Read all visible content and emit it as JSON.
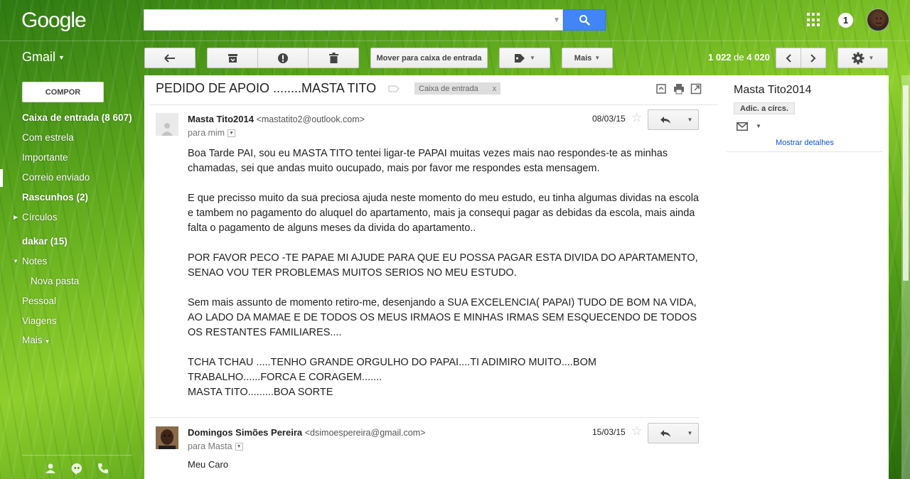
{
  "topbar": {
    "logo": "Google",
    "search": {
      "value": "",
      "placeholder": ""
    },
    "notification_count": "1"
  },
  "app_label": "Gmail",
  "toolbar": {
    "move_to_inbox": "Mover para caixa de entrada",
    "more": "Mais",
    "count_range": "1 022",
    "count_of": "de",
    "count_total": "4 020"
  },
  "sidebar": {
    "compose": "COMPOR",
    "items": [
      {
        "label": "Caixa de entrada (8 607)"
      },
      {
        "label": "Com estrela"
      },
      {
        "label": "Importante"
      },
      {
        "label": "Correio enviado"
      },
      {
        "label": "Rascunhos (2)"
      },
      {
        "label": "Círculos"
      },
      {
        "label": "dakar (15)"
      },
      {
        "label": "Notes"
      },
      {
        "label": "Nova pasta"
      },
      {
        "label": "Pessoal"
      },
      {
        "label": "Viagens"
      },
      {
        "label": "Mais"
      }
    ]
  },
  "thread": {
    "subject": "PEDIDO DE APOIO ........MASTA TITO",
    "label_chip": "Caixa de entrada",
    "label_chip_close": "x",
    "messages": [
      {
        "sender_name": "Masta Tito2014",
        "sender_email": "<mastatito2@outlook.com>",
        "to": "para mim",
        "date": "08/03/15",
        "body": [
          "Boa Tarde PAI, sou eu MASTA TITO tentei ligar-te PAPAI muitas vezes mais nao respondes-te  as minhas chamadas, sei que andas muito oucupado, mais por favor me respondes esta mensagem.",
          "E que precisso muito da sua preciosa ajuda neste momento do meu estudo, eu tinha algumas dividas na escola e tambem no pagamento do aluquel do apartamento, mais ja consequi pagar as debidas da escola, mais ainda falta o pagamento de alguns meses da divida do apartamento..",
          "POR FAVOR PECO -TE PAPAE MI AJUDE PARA QUE EU POSSA PAGAR ESTA DIVIDA DO APARTAMENTO, SENAO VOU TER PROBLEMAS MUITOS SERIOS NO MEU ESTUDO.",
          "Sem mais assunto de momento retiro-me, desenjando a SUA EXCELENCIA( PAPAI) TUDO DE BOM NA VIDA, AO LADO DA MAMAE E DE TODOS OS MEUS IRMAOS E MINHAS IRMAS SEM ESQUECENDO DE TODOS OS RESTANTES FAMILIARES....",
          "TCHA TCHAU .....TENHO GRANDE ORGULHO DO PAPAI....TI ADIMIRO MUITO....BOM TRABALHO......FORCA E CORAGEM.......",
          "MASTA TITO.........BOA SORTE"
        ]
      },
      {
        "sender_name": "Domingos Simões Pereira",
        "sender_email": "<dsimoespereira@gmail.com>",
        "to": "para Masta",
        "date": "15/03/15",
        "body_preview": "Meu Caro"
      }
    ]
  },
  "contact_panel": {
    "name": "Masta Tito2014",
    "add_to_circles": "Adic. a círcs.",
    "show_details": "Mostrar detalhes"
  },
  "colors": {
    "search_button": "#4285f4",
    "link": "#1155cc",
    "background_green": "#5aa51c"
  }
}
